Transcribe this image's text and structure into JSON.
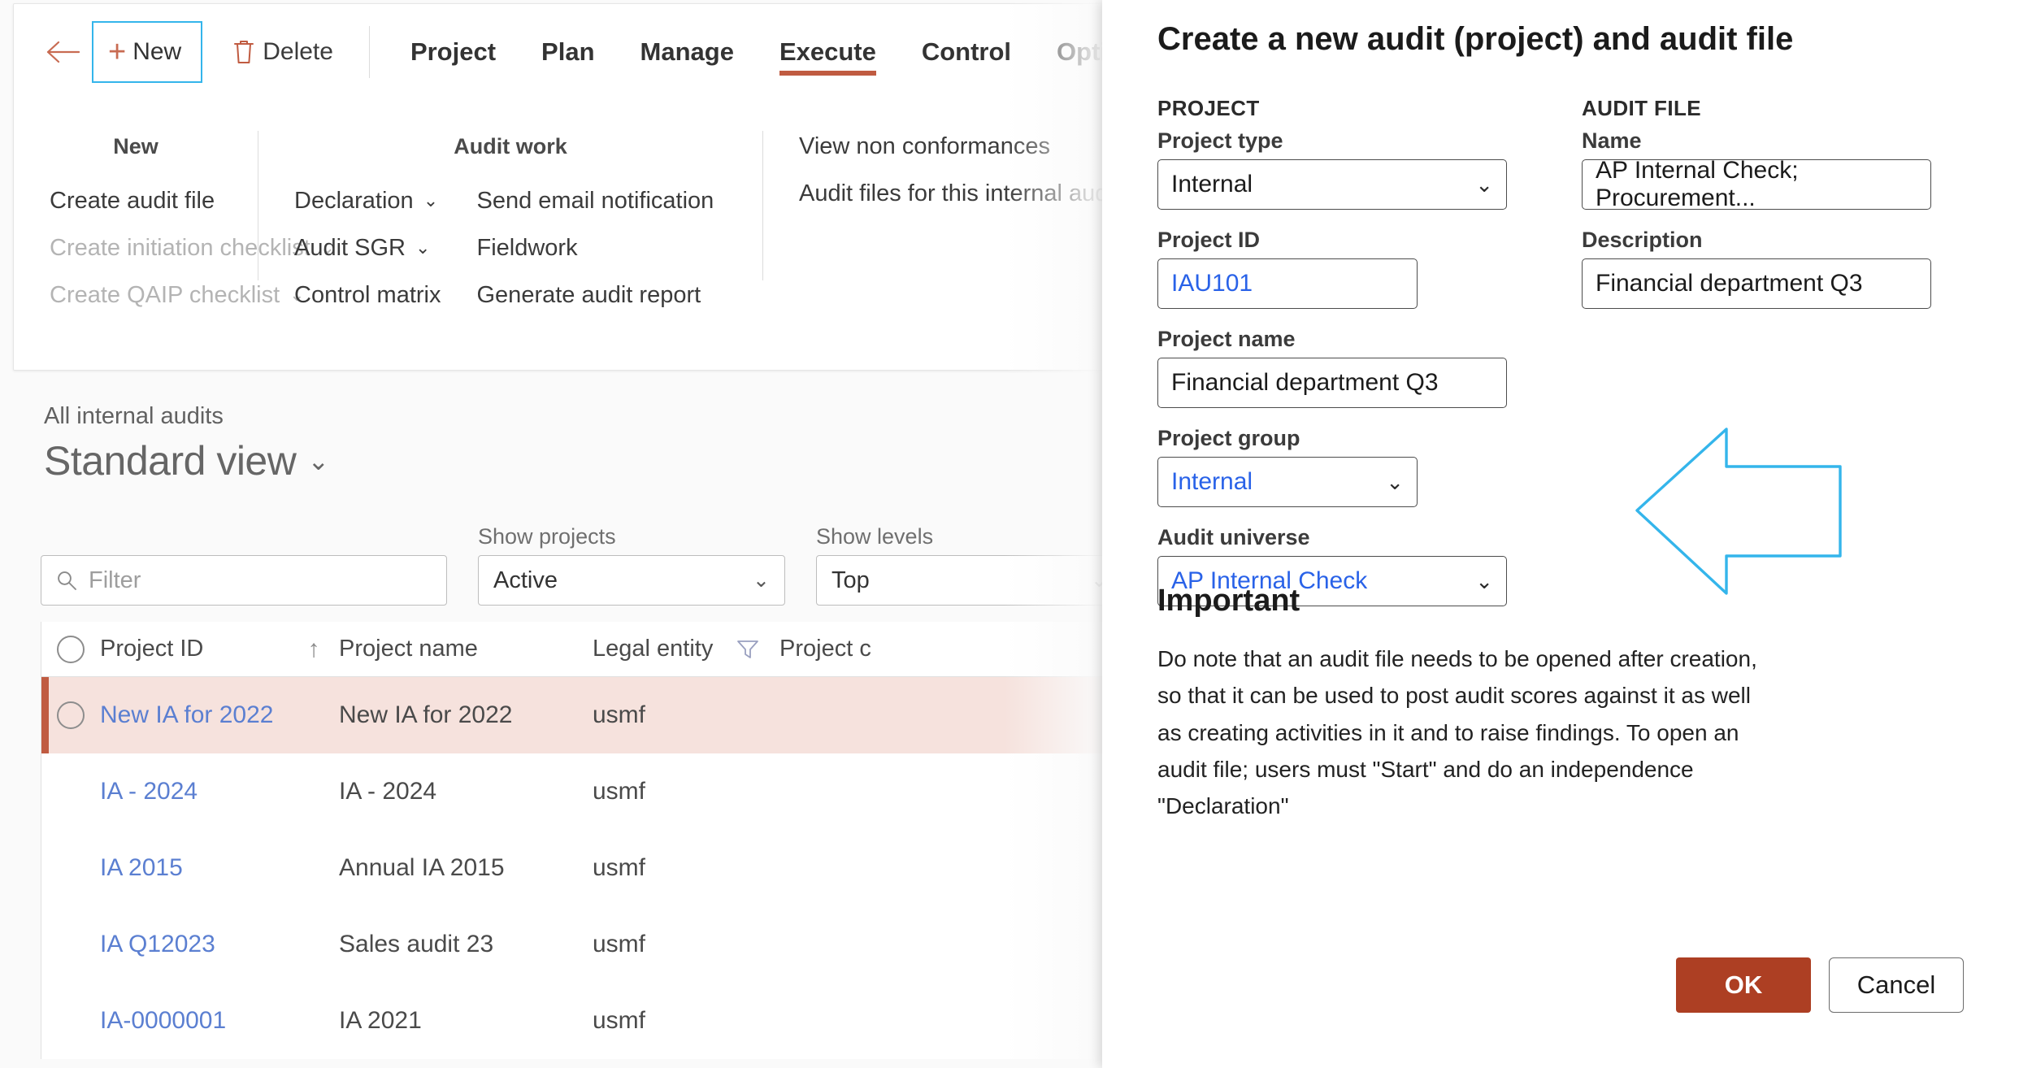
{
  "ribbon": {
    "back_icon": "back-arrow-icon",
    "new_button": "New",
    "delete_button": "Delete",
    "tabs": [
      {
        "label": "Project",
        "active": false
      },
      {
        "label": "Plan",
        "active": false
      },
      {
        "label": "Manage",
        "active": false
      },
      {
        "label": "Execute",
        "active": true
      },
      {
        "label": "Control",
        "active": false
      },
      {
        "label": "Options",
        "active": false
      }
    ],
    "groups": [
      {
        "title": "New",
        "columns": [
          [
            {
              "label": "Create audit file",
              "disabled": false,
              "chevron": false
            },
            {
              "label": "Create initiation checklist",
              "disabled": true,
              "chevron": true
            },
            {
              "label": "Create QAIP checklist",
              "disabled": true,
              "chevron": true
            }
          ]
        ]
      },
      {
        "title": "Audit work",
        "columns": [
          [
            {
              "label": "Declaration",
              "disabled": false,
              "chevron": true
            },
            {
              "label": "Audit SGR",
              "disabled": false,
              "chevron": true
            },
            {
              "label": "Control matrix",
              "disabled": false,
              "chevron": false
            }
          ],
          [
            {
              "label": "Send email notification",
              "disabled": false,
              "chevron": false
            },
            {
              "label": "Fieldwork",
              "disabled": false,
              "chevron": false
            },
            {
              "label": "Generate audit report",
              "disabled": false,
              "chevron": false
            }
          ]
        ]
      },
      {
        "title": "",
        "columns": [
          [
            {
              "label": "View non conformances",
              "disabled": false,
              "chevron": false
            },
            {
              "label": "Audit files for this internal audit",
              "disabled": false,
              "chevron": false
            }
          ]
        ]
      }
    ]
  },
  "page": {
    "breadcrumb": "All internal audits",
    "title": "Standard view",
    "title_chevron": "chevron-down-icon"
  },
  "filters": {
    "search": {
      "placeholder": "Filter",
      "value": "",
      "icon": "search-icon"
    },
    "show_projects": {
      "label": "Show projects",
      "value": "Active"
    },
    "show_levels": {
      "label": "Show levels",
      "value": "Top"
    }
  },
  "grid": {
    "columns": [
      "Project ID",
      "Project name",
      "Legal entity",
      "Project c"
    ],
    "sort_indicator": "sort-ascending-icon",
    "filter_icon": "funnel-icon",
    "rows": [
      {
        "project_id": "New IA for 2022",
        "project_name": "New IA for 2022",
        "legal_entity": "usmf",
        "selected": true
      },
      {
        "project_id": "IA - 2024",
        "project_name": "IA - 2024",
        "legal_entity": "usmf",
        "selected": false
      },
      {
        "project_id": "IA 2015",
        "project_name": "Annual IA 2015",
        "legal_entity": "usmf",
        "selected": false
      },
      {
        "project_id": "IA Q12023",
        "project_name": "Sales audit 23",
        "legal_entity": "usmf",
        "selected": false
      },
      {
        "project_id": "IA-0000001",
        "project_name": "IA 2021",
        "legal_entity": "usmf",
        "selected": false
      }
    ]
  },
  "dialog": {
    "title": "Create a new audit (project) and audit file",
    "project_section_label": "PROJECT",
    "auditfile_section_label": "AUDIT FILE",
    "fields": {
      "project_type": {
        "label": "Project type",
        "value": "Internal",
        "chevron": "chevron-down-icon"
      },
      "project_id": {
        "label": "Project ID",
        "value": "IAU101"
      },
      "project_name": {
        "label": "Project name",
        "value": "Financial department Q3"
      },
      "project_group": {
        "label": "Project group",
        "value": "Internal",
        "chevron": "chevron-down-icon"
      },
      "audit_universe": {
        "label": "Audit universe",
        "value": "AP Internal Check",
        "chevron": "chevron-down-icon"
      },
      "name": {
        "label": "Name",
        "value": "AP Internal Check; Procurement..."
      },
      "description": {
        "label": "Description",
        "value": "Financial department Q3"
      }
    },
    "important": {
      "heading": "Important",
      "body": "Do note that an audit file needs to be opened after creation, so that it can be used to post audit scores against it as well as creating activities in it and to raise findings. To open an audit file; users must \"Start\" and do an independence \"Declaration\""
    },
    "ok_button": "OK",
    "cancel_button": "Cancel",
    "annotation_icon": "left-arrow-annotation"
  },
  "colors": {
    "accent": "#c05b41",
    "primary_button": "#ad3f23",
    "link": "#5b7fd1",
    "annotation": "#34b5eb",
    "selected_row": "#f6e2dd",
    "field_blue_text": "#2962e8"
  }
}
